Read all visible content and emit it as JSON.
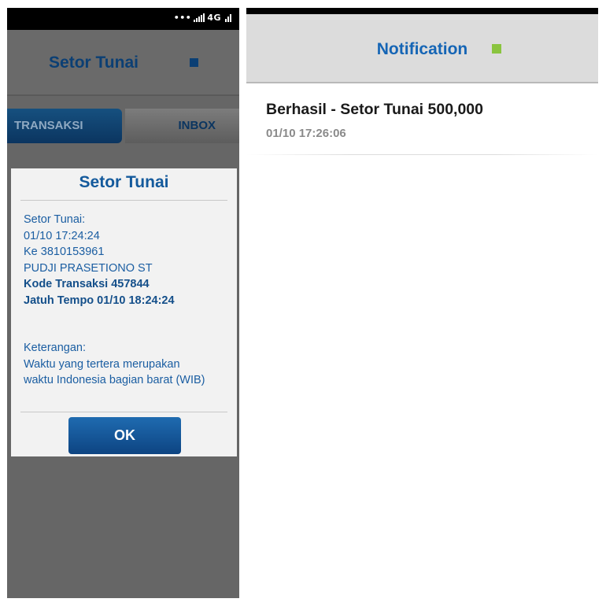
{
  "left": {
    "status": {
      "dots": "•••",
      "network": "4G"
    },
    "header": {
      "title": "Setor Tunai"
    },
    "tabs": [
      {
        "label": "TRANSAKSI"
      },
      {
        "label": "INBOX"
      }
    ],
    "dialog": {
      "title": "Setor Tunai",
      "lines": [
        "Setor Tunai:",
        "01/10 17:24:24",
        "Ke 3810153961",
        "PUDJI PRASETIONO ST"
      ],
      "bold_lines": [
        "Kode Transaksi 457844",
        "Jatuh Tempo 01/10 18:24:24"
      ],
      "note_lines": [
        "Keterangan:",
        "Waktu yang tertera merupakan",
        "waktu Indonesia bagian barat (WIB)"
      ],
      "ok_label": "OK"
    }
  },
  "right": {
    "header": {
      "title": "Notification"
    },
    "items": [
      {
        "title": "Berhasil - Setor Tunai 500,000",
        "time": "01/10 17:26:06"
      }
    ]
  },
  "colors": {
    "title_blue": "#0b3f74",
    "notif_blue": "#1565b5",
    "notif_square": "#8ac43f",
    "tab_active": "#16507f"
  }
}
